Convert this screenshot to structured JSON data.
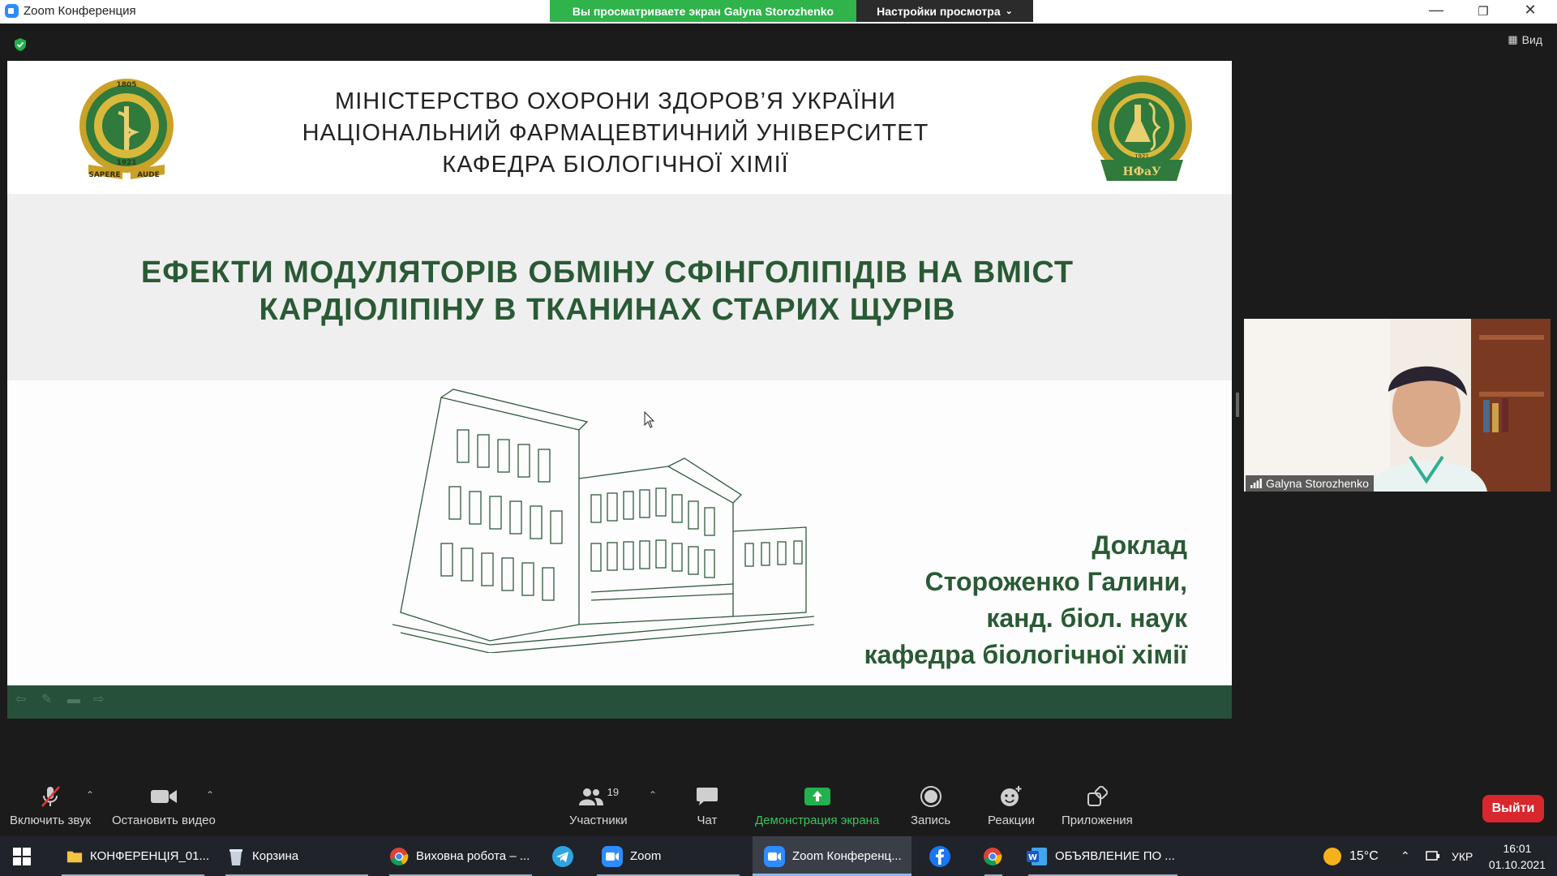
{
  "window": {
    "title": "Zoom Конференция",
    "share_banner": "Вы просматриваете экран Galyna Storozhenko",
    "view_options": "Настройки просмотра",
    "view_button": "Вид"
  },
  "slide": {
    "header_lines": [
      "МІНІСТЕРСТВО ОХОРОНИ ЗДОРОВ’Я УКРАЇНИ",
      "НАЦІОНАЛЬНИЙ ФАРМАЦЕВТИЧНИЙ УНІВЕРСИТЕТ",
      "КАФЕДРА БІОЛОГІЧНОЇ ХІМІЇ"
    ],
    "title_lines": [
      "ЕФЕКТИ МОДУЛЯТОРІВ ОБМІНУ СФІНГОЛІПІДІВ НА ВМІСТ",
      "КАРДІОЛІПІНУ В ТКАНИНАХ СТАРИХ ЩУРІВ"
    ],
    "report_lines": [
      "Доклад",
      "Стороженко Галини,",
      "канд. біол. наук",
      "кафедра біологічної хімії"
    ],
    "logo_left": {
      "year_top": "1805",
      "year_bottom": "1921",
      "motto_left": "SAPERE",
      "motto_right": "AUDE"
    },
    "logo_right": {
      "text": "НФаУ",
      "year": "1921"
    }
  },
  "participant": {
    "name": "Galyna Storozhenko"
  },
  "toolbar": {
    "unmute": "Включить звук",
    "stop_video": "Остановить видео",
    "participants": "Участники",
    "participants_count": "19",
    "chat": "Чат",
    "share_screen": "Демонстрация экрана",
    "record": "Запись",
    "reactions": "Реакции",
    "apps": "Приложения",
    "leave": "Выйти"
  },
  "taskbar": {
    "items": [
      {
        "label": "КОНФЕРЕНЦІЯ_01...",
        "icon": "folder-icon"
      },
      {
        "label": "Корзина",
        "icon": "recycle-bin-icon"
      },
      {
        "label": "Виховна робота – ...",
        "icon": "chrome-icon"
      },
      {
        "label": "",
        "icon": "telegram-icon"
      },
      {
        "label": "Zoom",
        "icon": "zoom-icon"
      },
      {
        "label": "Zoom Конференц...",
        "icon": "zoom-icon"
      },
      {
        "label": "",
        "icon": "facebook-icon"
      },
      {
        "label": "",
        "icon": "chrome-icon"
      },
      {
        "label": "ОБЪЯВЛЕНИЕ ПО ...",
        "icon": "word-icon"
      }
    ],
    "weather": "15°C",
    "language": "УКР",
    "time": "16:01",
    "date": "01.10.2021"
  }
}
